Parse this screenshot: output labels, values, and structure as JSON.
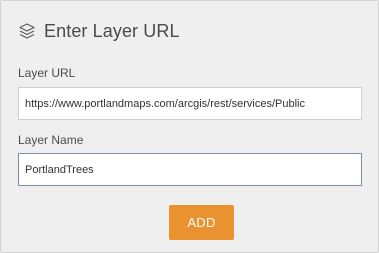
{
  "header": {
    "title": "Enter Layer URL",
    "icon": "layers-icon"
  },
  "form": {
    "url_label": "Layer URL",
    "url_value": "https://www.portlandmaps.com/arcgis/rest/services/Public",
    "name_label": "Layer Name",
    "name_value": "PortlandTrees",
    "add_label": "ADD"
  },
  "colors": {
    "panel_background": "#efefef",
    "button_accent": "#e9922f",
    "focused_border": "#7a8fb0"
  }
}
